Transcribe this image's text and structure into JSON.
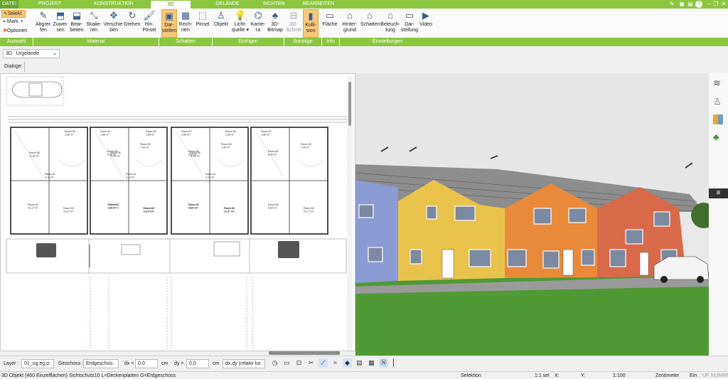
{
  "tabs": [
    "DATEI",
    "PROJEKT",
    "KONSTRUKTION",
    "3D",
    "GELÄNDE",
    "SICHTEN",
    "BEARBEITEN"
  ],
  "active_tab": "3D",
  "auswahl": {
    "selekt": "Selekt",
    "mark": "Mark.",
    "optionen": "Optionen",
    "group": "Auswahl"
  },
  "ribbon_buttons": [
    {
      "l1": "Abgrei-",
      "l2": "fen",
      "icon": "eyedropper-icon"
    },
    {
      "l1": "Zuwei-",
      "l2": "sen",
      "icon": "assign-icon"
    },
    {
      "l1": "Bear-",
      "l2": "beiten",
      "icon": "edit-material-icon"
    },
    {
      "l1": "Skalie-",
      "l2": "ren",
      "icon": "scale-icon"
    },
    {
      "l1": "Verschie-",
      "l2": "ben",
      "icon": "move-icon"
    },
    {
      "l1": "Drehen",
      "l2": "",
      "icon": "rotate-icon"
    },
    {
      "l1": "Hin.",
      "l2": "Pinsel",
      "icon": "brush-icon"
    },
    {
      "l1": "Dar-",
      "l2": "stellen",
      "icon": "display-icon"
    },
    {
      "l1": "Rech-",
      "l2": "nen",
      "icon": "calculate-icon"
    },
    {
      "l1": "Pinsel",
      "l2": "",
      "icon": "shadow-brush-icon"
    },
    {
      "l1": "Objekt",
      "l2": "",
      "icon": "chair-icon"
    },
    {
      "l1": "Licht-",
      "l2": "quelle ▾",
      "icon": "lightbulb-icon"
    },
    {
      "l1": "Kame-",
      "l2": "ra",
      "icon": "camera-icon"
    },
    {
      "l1": "3D-",
      "l2": "Bitmap",
      "icon": "tree-icon"
    },
    {
      "l1": "3D-",
      "l2": "Schnitt",
      "icon": "section-icon"
    },
    {
      "l1": "Kolli-",
      "l2": "sion",
      "icon": "collision-icon"
    },
    {
      "l1": "Fläche",
      "l2": "",
      "icon": "area-icon"
    },
    {
      "l1": "Hinter-",
      "l2": "grund",
      "icon": "background-icon"
    },
    {
      "l1": "Schatten",
      "l2": "",
      "icon": "shadow-house-icon"
    },
    {
      "l1": "Beleuch-",
      "l2": "tung",
      "icon": "lighting-house-icon"
    },
    {
      "l1": "Dar-",
      "l2": "stellung",
      "icon": "monitor-icon"
    },
    {
      "l1": "Video",
      "l2": "",
      "icon": "play-icon"
    }
  ],
  "groups": [
    "Material",
    "Schatten",
    "Einfügen",
    "Sonstige",
    "Info",
    "Einstellungen"
  ],
  "view": {
    "mode": "3D",
    "terrain": "Urgelände"
  },
  "dialoge": "Dialoge:",
  "plan_rooms": [
    {
      "name": "Raum 56",
      "area": "1,68 m²"
    },
    {
      "name": "Raum 57",
      "area": "1,88 m²"
    },
    {
      "name": "Raum 59",
      "area": "7,45 m²"
    },
    {
      "name": "Raum 58",
      "area": "11,80 m²"
    },
    {
      "name": "Raum 60",
      "area": "6,45 m²"
    },
    {
      "name": "Raum 61",
      "area": "3,14 m²"
    },
    {
      "name": "Raum 62",
      "area": "14,17 m²"
    },
    {
      "name": "Raum 63",
      "area": "13,37 m²"
    },
    {
      "name": "Raum 65",
      "area": "5,60 m²"
    },
    {
      "name": "Raum 64",
      "area": "13,17 m²"
    }
  ],
  "bottom": {
    "layer_label": "Layer :",
    "layer_value": "01_ug,eg,o:",
    "geschoss_label": "Geschoss :",
    "geschoss_value": "Erdgeschos:",
    "dx_label": "dx =",
    "dx_value": "0,0",
    "dx_unit": "cm",
    "dy_label": "dy =",
    "dy_value": "0,0",
    "dy_unit": "cm",
    "mode_value": "dx,dy (relativ ka"
  },
  "status": {
    "info": "3D Objekt (460 Einzelflächen) Sichtschutz10 L=Deckenplatten G=Erdgeschoss",
    "mode": "Selektion",
    "sel": "1:1 sel",
    "x": "X:",
    "y": "Y:",
    "scale": "1:100",
    "unit": "Zentimeter",
    "ein": "Ein",
    "uf": "UF",
    "num": "NUM",
    "rf": "RF"
  },
  "colors": {
    "green": "#8cc63f",
    "accent": "#f9c77a"
  }
}
